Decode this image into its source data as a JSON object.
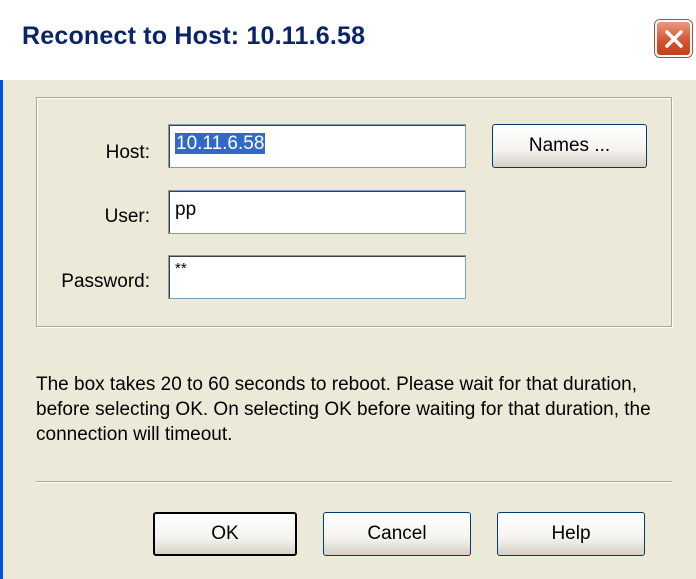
{
  "window": {
    "title": "Reconect to Host: 10.11.6.58",
    "close_icon": "close-icon",
    "accent_color": "#0a246a",
    "close_color": "#d4512b"
  },
  "form": {
    "host_label": "Host:",
    "host_value": "10.11.6.58",
    "user_label": "User:",
    "user_value": "pp",
    "password_label": "Password:",
    "password_value": "**",
    "names_button": "Names ..."
  },
  "message": "The box takes 20 to 60 seconds to reboot. Please wait for that duration, before selecting OK. On selecting OK before waiting for that duration, the connection will timeout.",
  "buttons": {
    "ok": "OK",
    "cancel": "Cancel",
    "help": "Help"
  }
}
